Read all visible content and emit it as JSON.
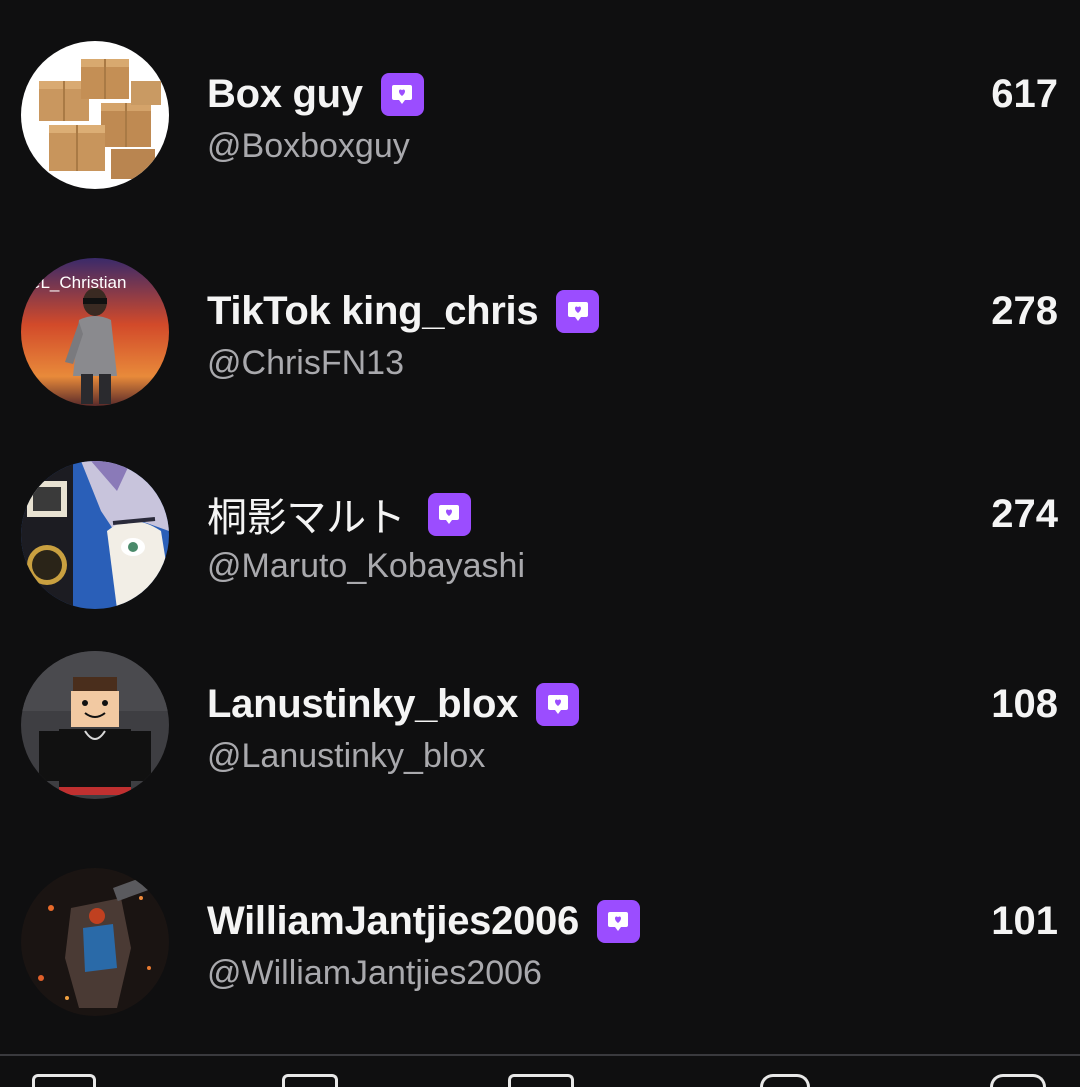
{
  "accent_color": "#9b4dff",
  "badge_icon": "heart-chat-icon",
  "users": [
    {
      "name": "Box guy",
      "handle": "@Boxboxguy",
      "count": "617"
    },
    {
      "name": "TikTok king_chris",
      "handle": "@ChrisFN13",
      "count": "278",
      "avatar_text": "eL_Christian"
    },
    {
      "name": "桐影マルト",
      "handle": "@Maruto_Kobayashi",
      "count": "274"
    },
    {
      "name": "Lanustinky_blox",
      "handle": "@Lanustinky_blox",
      "count": "108"
    },
    {
      "name": "WilliamJantjies2006",
      "handle": "@WilliamJantjies2006",
      "count": "101"
    }
  ],
  "bottom_nav": [
    {
      "icon": "home-icon"
    },
    {
      "icon": "explore-icon"
    },
    {
      "icon": "create-icon"
    },
    {
      "icon": "inbox-icon"
    },
    {
      "icon": "profile-icon"
    }
  ]
}
